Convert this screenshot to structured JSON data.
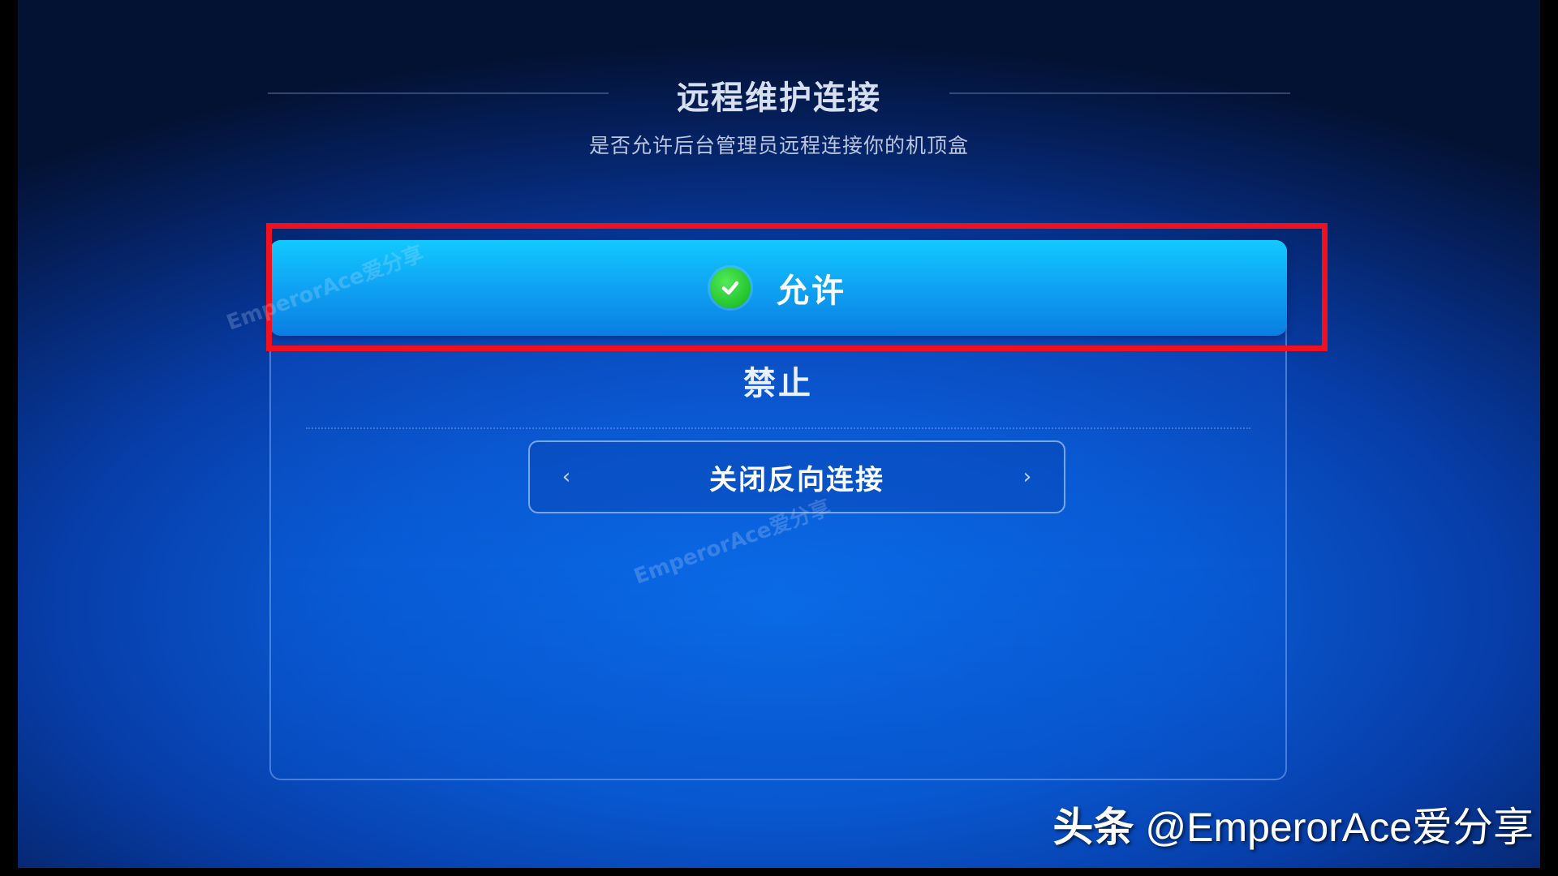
{
  "dialog": {
    "title": "远程维护连接",
    "subtitle": "是否允许后台管理员远程连接你的机顶盒"
  },
  "options": [
    {
      "label": "允许",
      "selected": true,
      "icon": "checkmark-circle-icon"
    },
    {
      "label": "禁止",
      "selected": false
    }
  ],
  "reverse_connection": {
    "value": "关闭反向连接",
    "prev_icon": "‹",
    "next_icon": "›"
  },
  "watermark": "EmperorAce爱分享",
  "attribution": {
    "source": "头条",
    "handle": "@EmperorAce爱分享"
  },
  "colors": {
    "highlight_border": "#f0101e",
    "selected_option": "#0fa6f4",
    "check_green": "#22c42c",
    "background": "#0858d0"
  }
}
